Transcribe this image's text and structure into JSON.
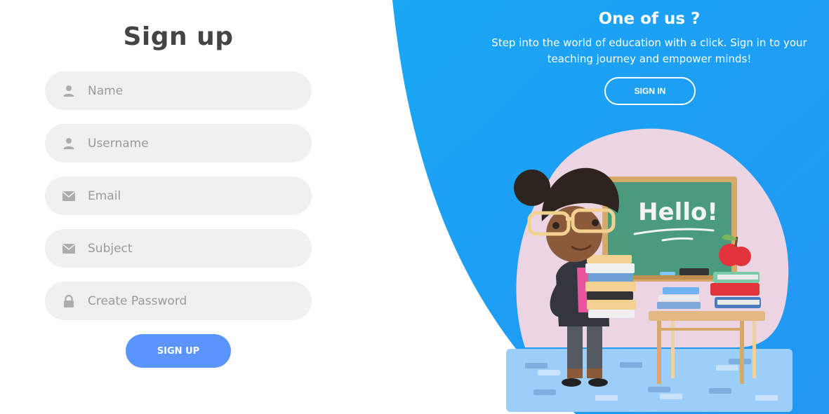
{
  "signup": {
    "title": "Sign up",
    "fields": [
      {
        "placeholder": "Name",
        "icon": "user-icon"
      },
      {
        "placeholder": "Username",
        "icon": "user-icon"
      },
      {
        "placeholder": "Email",
        "icon": "envelope-icon"
      },
      {
        "placeholder": "Subject",
        "icon": "envelope-icon"
      },
      {
        "placeholder": "Create Password",
        "icon": "lock-icon"
      }
    ],
    "button_label": "SIGN UP"
  },
  "info": {
    "heading": "One of us ?",
    "text": "Step into the world of education with a click. Sign in to your teaching journey and empower minds!",
    "button_label": "SIGN IN"
  },
  "illustration": {
    "board_text": "Hello!"
  },
  "colors": {
    "panel_blue": "#1aa7f5",
    "button_blue": "#5995fd",
    "field_bg": "#f0f0f0",
    "icon_gray": "#acacac",
    "title_gray": "#444444"
  }
}
